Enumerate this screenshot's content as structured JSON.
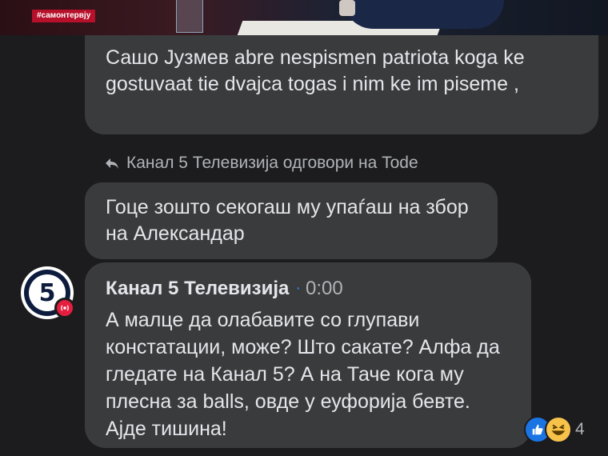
{
  "video": {
    "tag": "#самонтервју"
  },
  "comments": [
    {
      "text": "Сашо Јузмев abre nespismen patriota koga ke gostuvaat tie dvajca togas i nim ke im piseme ,"
    }
  ],
  "reply_notice": {
    "icon": "reply-arrow-icon",
    "text": "Канал 5 Телевизија одговори на Tode"
  },
  "reply_comment": {
    "text": "Гоце зошто секогаш му упаѓаш на збор на Александар"
  },
  "page_comment": {
    "author": "Канал 5 Телевизија",
    "separator": "·",
    "timestamp": "0:00",
    "text": "А малце да олабавите со глупави констатации, може? Што сакате? Алфа да гледате на Канал 5? А на Таче кога му плесна за balls, овде у еуфорија бевте. Ајде тишина!",
    "avatar_label": "5",
    "avatar_badge_icon": "live-broadcast-icon",
    "reactions": {
      "icons": [
        "like-icon",
        "haha-icon"
      ],
      "count": "4"
    }
  },
  "colors": {
    "background": "#1c1c1e",
    "bubble": "#3a3b3c",
    "text": "#e4e6eb",
    "secondary_text": "#b0b3b8",
    "like_blue": "#1b74e4",
    "live_red": "#e41e3f"
  }
}
